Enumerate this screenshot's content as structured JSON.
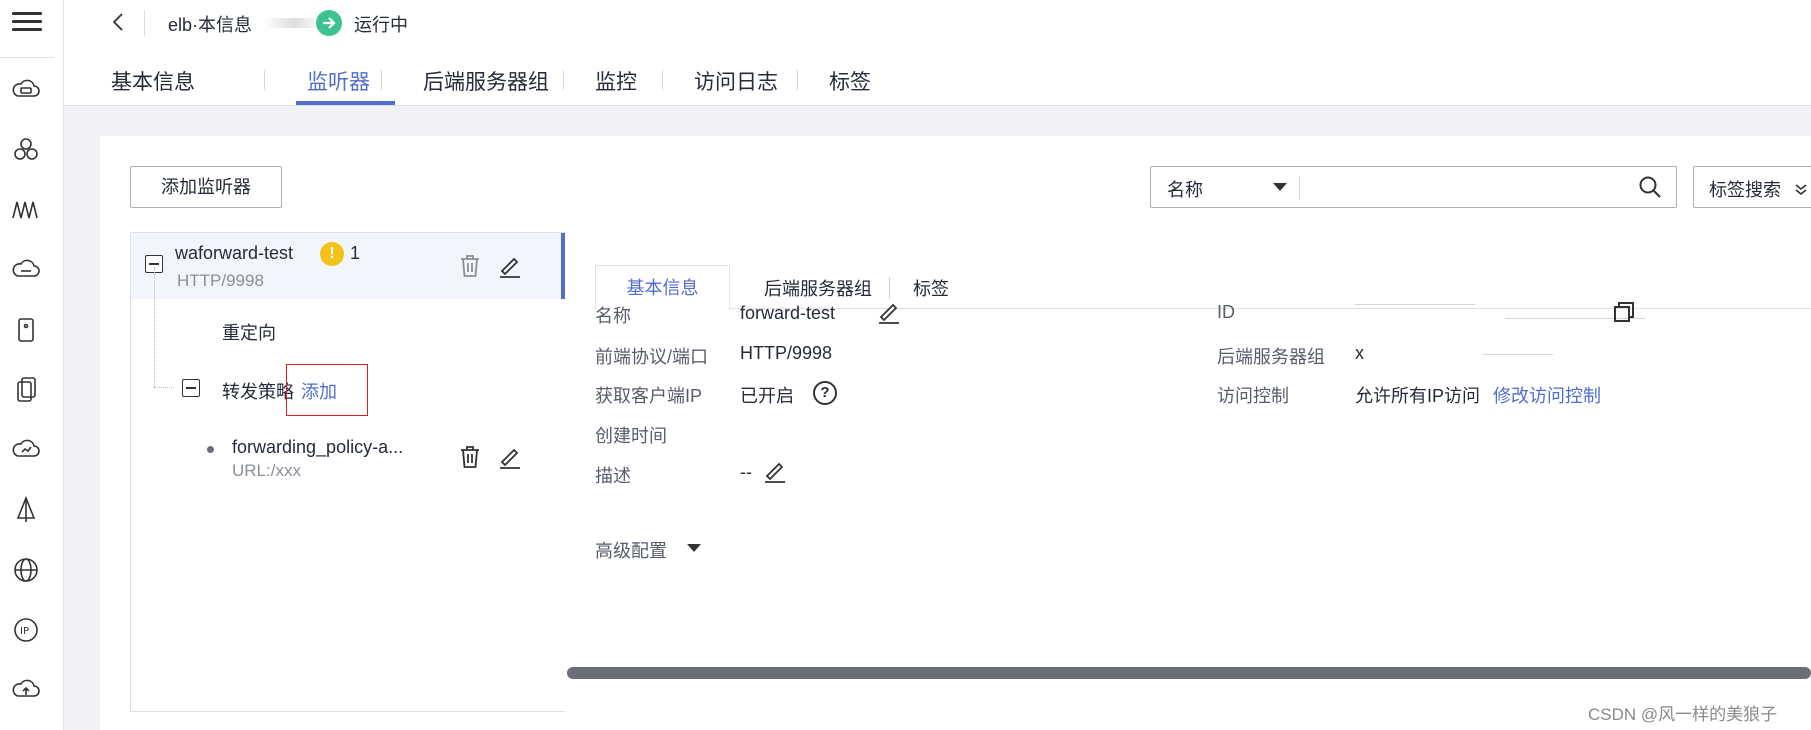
{
  "header": {
    "elb_name": "elb·本信息",
    "status": "运行中",
    "tabs": [
      "基本信息",
      "监听器",
      "后端服务器组",
      "监控",
      "访问日志",
      "标签"
    ],
    "active_tab": "监听器"
  },
  "toolbar": {
    "add_listener_label": "添加监听器",
    "search_field": "名称",
    "search_placeholder": "",
    "tag_search_label": "标签搜索"
  },
  "tree": {
    "listener": {
      "name": "waforward-test",
      "warning_count": "1",
      "protocol": "HTTP/9998"
    },
    "redirect_label": "重定向",
    "forward_policy_label": "转发策略",
    "add_link": "添加",
    "policy": {
      "name": "forwarding_policy-a...",
      "sub": "URL:/xxx"
    }
  },
  "detail": {
    "tabs": [
      "基本信息",
      "后端服务器组",
      "标签"
    ],
    "active_tab": "基本信息",
    "fields": {
      "name_label": "名称",
      "name_value": "forward-test",
      "protocol_label": "前端协议/端口",
      "protocol_value": "HTTP/9998",
      "client_ip_label": "获取客户端IP",
      "client_ip_value": "已开启",
      "created_label": "创建时间",
      "desc_label": "描述",
      "desc_value": "--",
      "id_label": "ID",
      "backend_label": "后端服务器组",
      "backend_value": "x",
      "acl_label": "访问控制",
      "acl_value": "允许所有IP访问",
      "acl_link": "修改访问控制"
    },
    "advanced_label": "高级配置"
  },
  "watermark": "CSDN @风一样的美狼子",
  "colors": {
    "accent": "#526ecc",
    "running": "#3ec28f",
    "warning": "#f5c219",
    "highlight_box": "#e02020"
  }
}
